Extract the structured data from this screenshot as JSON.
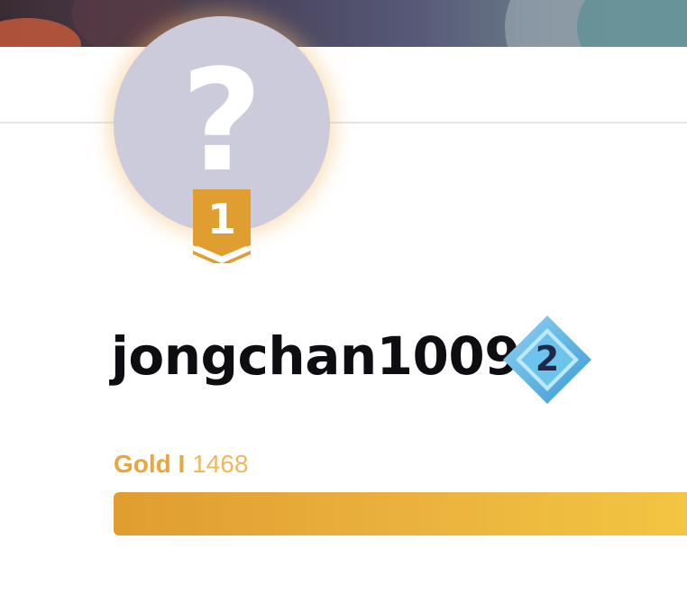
{
  "profile": {
    "avatar_placeholder": "?",
    "rank": "1",
    "username": "jongchan1009",
    "level": "2",
    "tier_name": "Gold I",
    "tier_score": "1468",
    "tier_progress": 1.0
  },
  "colors": {
    "gold": "#e8a73e",
    "avatar_bg": "#cccbdc",
    "level_blue": "#5ab2e3",
    "text_dark": "#0d0d12"
  }
}
